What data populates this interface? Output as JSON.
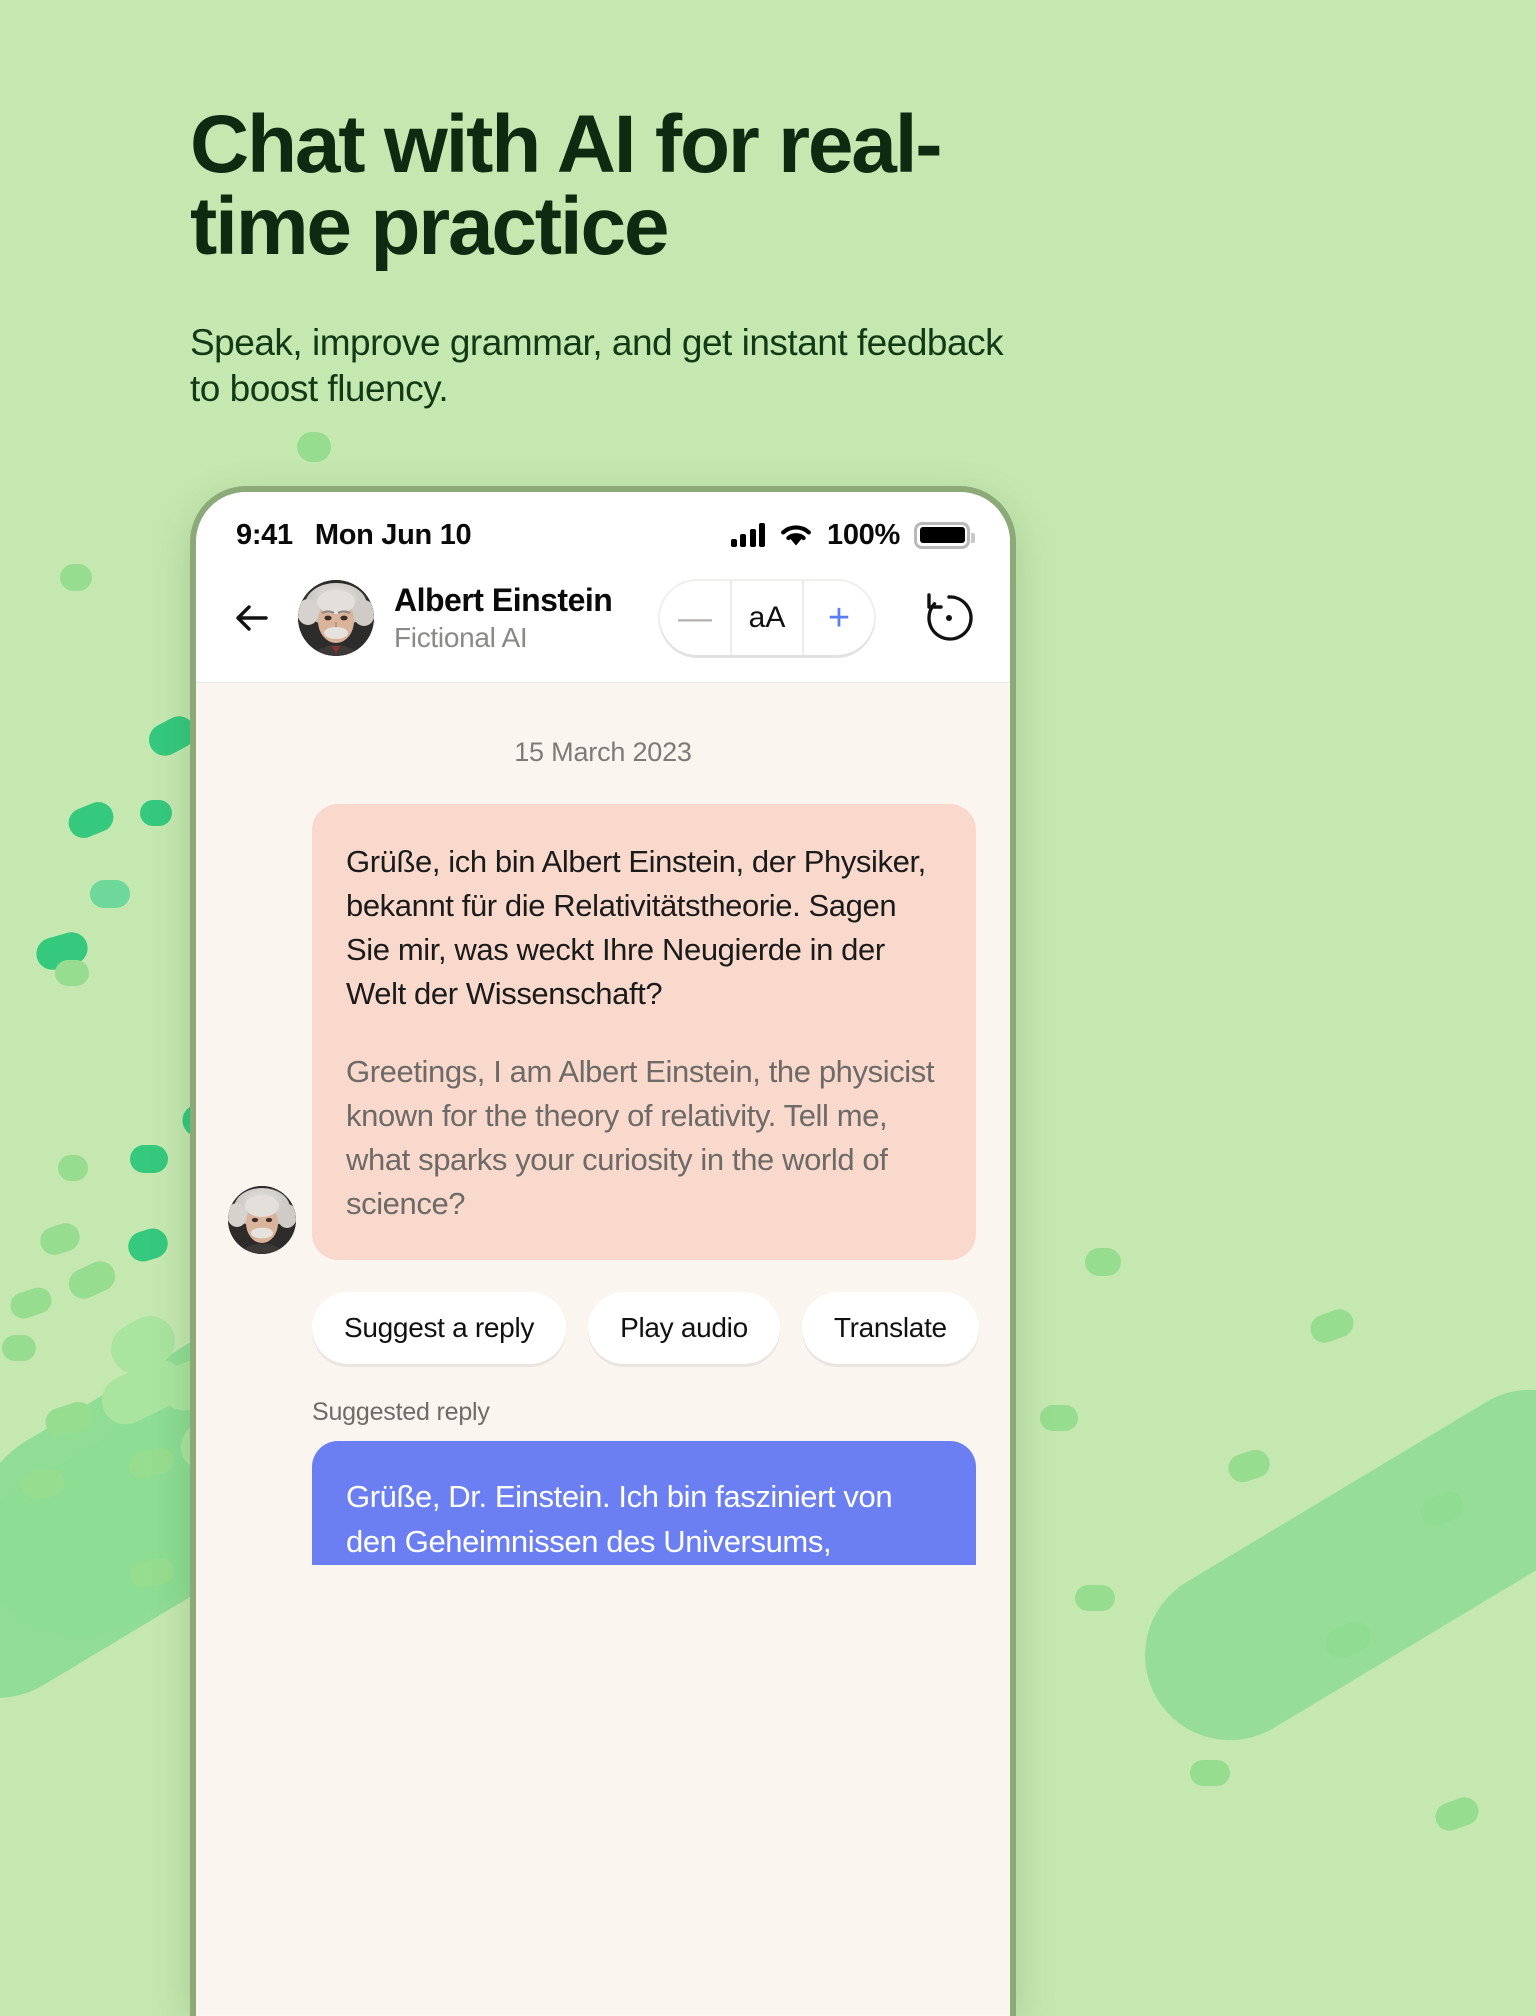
{
  "hero": {
    "title": "Chat with AI for real-\ntime practice",
    "subtitle": "Speak, improve grammar, and get instant feedback\nto boost fluency."
  },
  "colors": {
    "page_background": "#c5e8b0",
    "deco_light": "#97dd8f",
    "deco_mid": "#6ed89a",
    "deco_dark": "#35c97e",
    "phone_frame": "#8ca978",
    "screen_background": "#fbf5f0",
    "ai_bubble": "#f9d9cc",
    "user_bubble": "#6b7ff2",
    "accent_blue": "#5b7cf5"
  },
  "phone": {
    "status_bar": {
      "time": "9:41",
      "date": "Mon Jun 10",
      "battery_percent": "100%",
      "signal_icon": "cellular-signal-icon",
      "wifi_icon": "wifi-icon",
      "battery_icon": "battery-full-icon"
    },
    "chat_header": {
      "back_icon": "back-arrow-icon",
      "avatar_icon": "albert-einstein-avatar",
      "name": "Albert Einstein",
      "subtitle": "Fictional AI",
      "font_control": {
        "decrease_label": "—",
        "size_label": "aA",
        "increase_label": "+",
        "decrease_icon": "minus-icon",
        "increase_icon": "plus-icon"
      },
      "reset_icon": "reset-history-icon"
    },
    "conversation": {
      "date_separator": "15 March 2023",
      "messages": [
        {
          "sender": "ai",
          "avatar_icon": "albert-einstein-avatar-small",
          "text_source": "Grüße, ich bin Albert Einstein, der Physiker, bekannt für die Relativitätstheorie. Sagen Sie mir, was weckt Ihre Neugierde in der Welt der Wissenschaft?",
          "text_translation": "Greetings, I am Albert Einstein, the physicist known for the theory of relativity. Tell me, what sparks your curiosity in the world of science?"
        }
      ],
      "action_chips": [
        {
          "label": "Suggest a reply"
        },
        {
          "label": "Play audio"
        },
        {
          "label": "Translate"
        }
      ],
      "suggested_reply_label": "Suggested reply",
      "suggested_reply_text": "Grüße, Dr. Einstein. Ich bin fasziniert von den Geheimnissen des Universums,"
    }
  }
}
